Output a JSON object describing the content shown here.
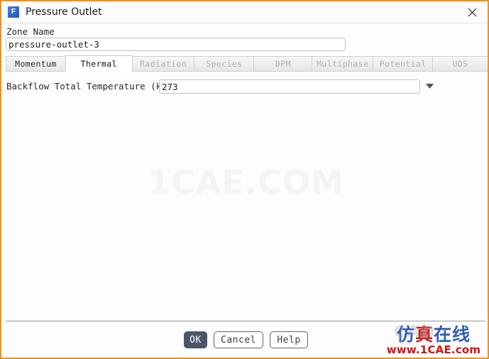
{
  "window": {
    "title": "Pressure Outlet",
    "icon": "fluent-app-icon",
    "close_icon": "close-icon"
  },
  "zone": {
    "label": "Zone Name",
    "value": "pressure-outlet-3",
    "placeholder": ""
  },
  "tabs": [
    {
      "label": "Momentum",
      "state": "enabled"
    },
    {
      "label": "Thermal",
      "state": "active"
    },
    {
      "label": "Radiation",
      "state": "disabled"
    },
    {
      "label": "Species",
      "state": "disabled"
    },
    {
      "label": "DPM",
      "state": "disabled"
    },
    {
      "label": "Multiphase",
      "state": "disabled"
    },
    {
      "label": "Potential",
      "state": "disabled"
    },
    {
      "label": "UDS",
      "state": "disabled"
    }
  ],
  "thermal": {
    "temperature_label": "Backflow Total Temperature (k)",
    "temperature_value": "273",
    "dropdown_icon": "chevron-down-icon"
  },
  "footer": {
    "ok_label": "OK",
    "cancel_label": "Cancel",
    "help_label": "Help"
  },
  "watermarks": {
    "center": "1CAE.COM",
    "logo_ghost": "CAD",
    "logo_cn_1": "仿",
    "logo_cn_2": "真",
    "logo_cn_3": "在",
    "logo_cn_4": "线",
    "logo_url": "www.1CAE.com"
  },
  "colors": {
    "accent_border": "#f0901e",
    "primary_button": "#4a5568",
    "input_border": "#b9c2ce",
    "logo_red": "#d01414",
    "logo_blue": "#2f5fb5"
  }
}
